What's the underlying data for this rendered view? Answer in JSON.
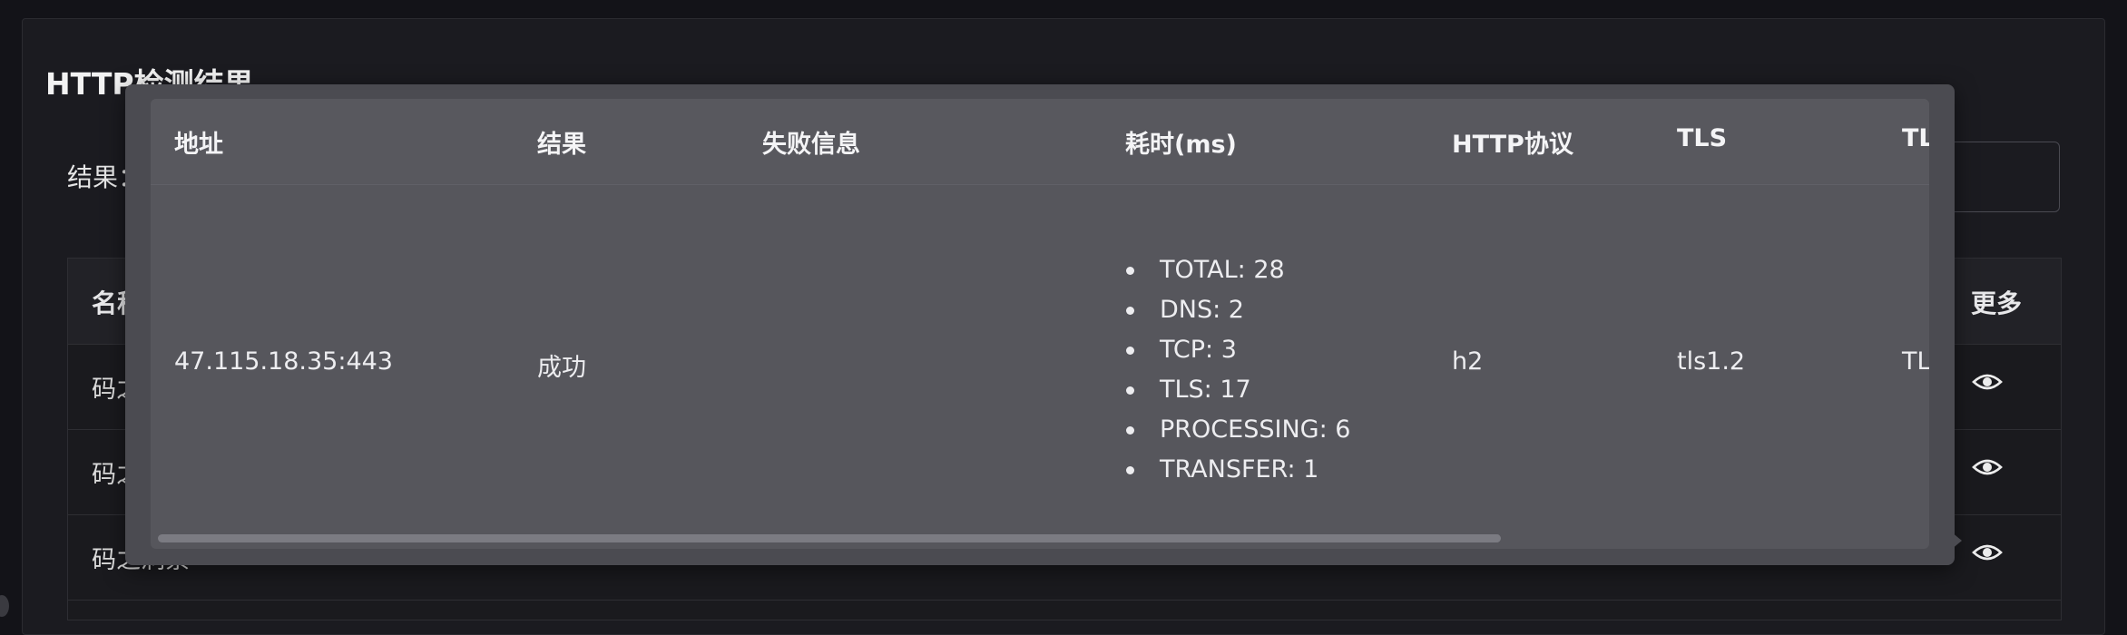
{
  "page": {
    "title": "HTTP检测结果",
    "filter_label": "结果："
  },
  "background_table": {
    "headers": {
      "name": "名称",
      "more": "更多"
    },
    "rows": [
      {
        "name": "码之洞察"
      },
      {
        "name": "码之洞察"
      },
      {
        "name": "码之洞察"
      }
    ]
  },
  "popover": {
    "headers": {
      "address": "地址",
      "result": "结果",
      "error": "失败信息",
      "timing": "耗时(ms)",
      "http_protocol": "HTTP协议",
      "tls": "TLS",
      "tls_extra": "TL"
    },
    "row": {
      "address": "47.115.18.35:443",
      "result": "成功",
      "error": "",
      "timing": [
        "TOTAL: 28",
        "DNS: 2",
        "TCP: 3",
        "TLS: 17",
        "PROCESSING: 6",
        "TRANSFER: 1"
      ],
      "http_protocol": "h2",
      "tls": "tls1.2",
      "tls_extra": "TL"
    }
  },
  "colors": {
    "background": "#131318",
    "popover": "#4b4b51",
    "text": "#e8e8ea"
  }
}
